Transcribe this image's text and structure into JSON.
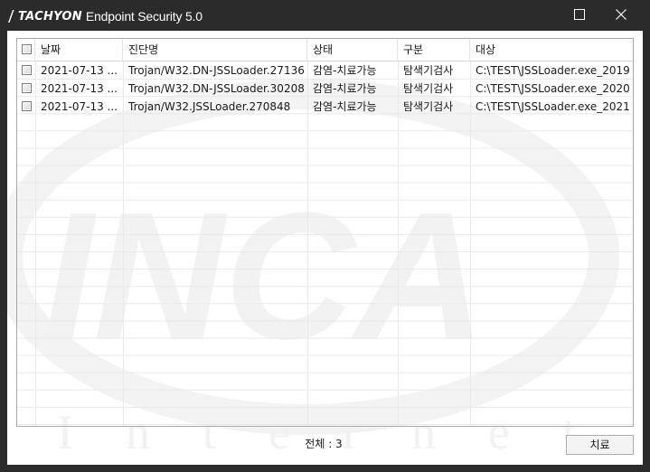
{
  "window": {
    "brand": "TACHYON",
    "title": "Endpoint Security 5.0"
  },
  "grid": {
    "columns": [
      "날짜",
      "진단명",
      "상태",
      "구분",
      "대상"
    ],
    "rows": [
      {
        "date": "2021-07-13 ...",
        "name": "Trojan/W32.DN-JSSLoader.27136",
        "status": "감염-치료가능",
        "type": "탐색기검사",
        "target": "C:\\TEST\\JSSLoader.exe_2019"
      },
      {
        "date": "2021-07-13 ...",
        "name": "Trojan/W32.DN-JSSLoader.30208",
        "status": "감염-치료가능",
        "type": "탐색기검사",
        "target": "C:\\TEST\\JSSLoader.exe_2020"
      },
      {
        "date": "2021-07-13 ...",
        "name": "Trojan/W32.JSSLoader.270848",
        "status": "감염-치료가능",
        "type": "탐색기검사",
        "target": "C:\\TEST\\JSSLoader.exe_2021"
      }
    ]
  },
  "footer": {
    "total": "전체 : 3",
    "treat_button": "치료"
  },
  "watermark": {
    "logo": "INCA",
    "sub": "Internet"
  },
  "colors": {
    "titlebar": "#2b2b2b",
    "client": "#ffffff",
    "watermark": "#f2f2f2"
  }
}
